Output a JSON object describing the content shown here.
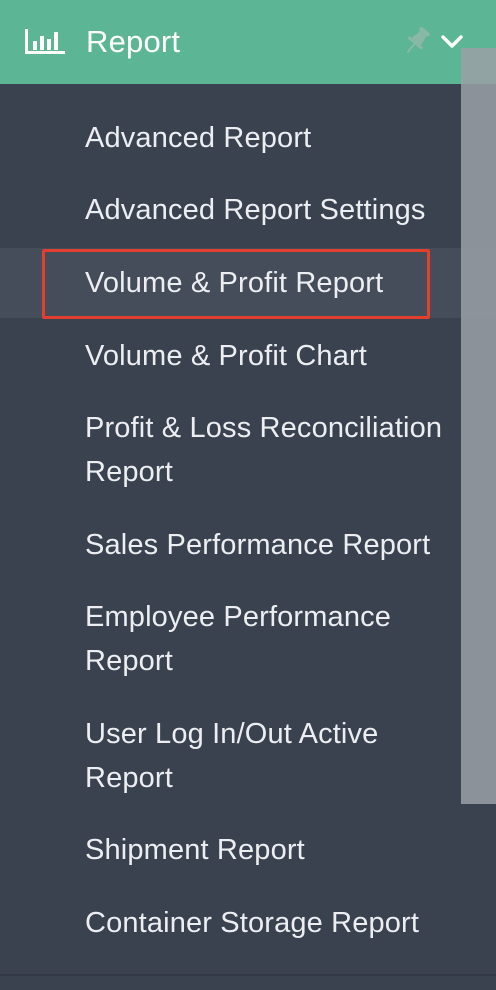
{
  "header": {
    "title": "Report",
    "icon": "bar-chart-icon",
    "pin_icon": "pin-icon",
    "chevron_icon": "chevron-down-icon",
    "background_color": "#5cb594"
  },
  "menu": {
    "background_color": "#3a4250",
    "highlight_color": "#e0402d",
    "items": [
      {
        "label": "Advanced Report"
      },
      {
        "label": "Advanced Report Settings"
      },
      {
        "label": "Volume & Profit Report",
        "active": true
      },
      {
        "label": "Volume & Profit Chart"
      },
      {
        "label_line1": "Profit & Loss Reconciliation",
        "label_line2": "Report"
      },
      {
        "label": "Sales Performance Report"
      },
      {
        "label_line1": "Employee Performance",
        "label_line2": "Report"
      },
      {
        "label_line1": "User Log In/Out Active",
        "label_line2": "Report"
      },
      {
        "label": "Shipment Report"
      },
      {
        "label": "Container Storage Report"
      }
    ]
  }
}
